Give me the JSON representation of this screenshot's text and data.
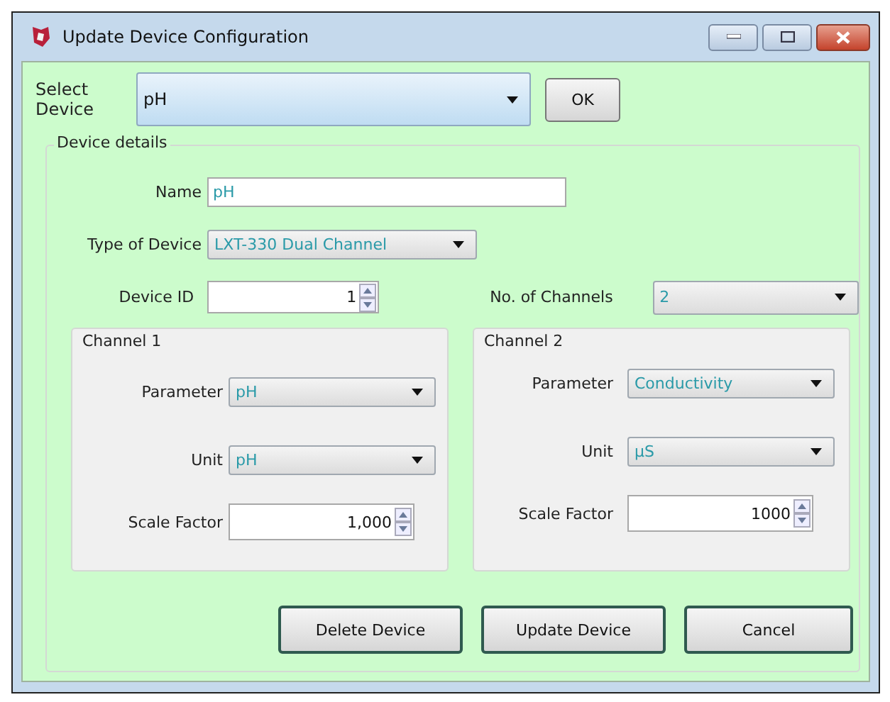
{
  "window": {
    "title": "Update Device Configuration"
  },
  "select_device": {
    "label": "Select Device",
    "value": "pH"
  },
  "ok_button": "OK",
  "device_details": {
    "title": "Device details",
    "name": {
      "label": "Name",
      "value": "pH"
    },
    "type_of_device": {
      "label": "Type of Device",
      "value": "LXT-330 Dual Channel"
    },
    "device_id": {
      "label": "Device ID",
      "value": "1"
    },
    "no_of_channels": {
      "label": "No. of Channels",
      "value": "2"
    },
    "channels": [
      {
        "title": "Channel 1",
        "parameter": {
          "label": "Parameter",
          "value": "pH"
        },
        "unit": {
          "label": "Unit",
          "value": "pH"
        },
        "scale_factor": {
          "label": "Scale Factor",
          "value": "1,000"
        }
      },
      {
        "title": "Channel 2",
        "parameter": {
          "label": "Parameter",
          "value": "Conductivity"
        },
        "unit": {
          "label": "Unit",
          "value": "µS"
        },
        "scale_factor": {
          "label": "Scale Factor",
          "value": "1000"
        }
      }
    ]
  },
  "buttons": [
    "Delete Device",
    "Update Device",
    "Cancel"
  ]
}
